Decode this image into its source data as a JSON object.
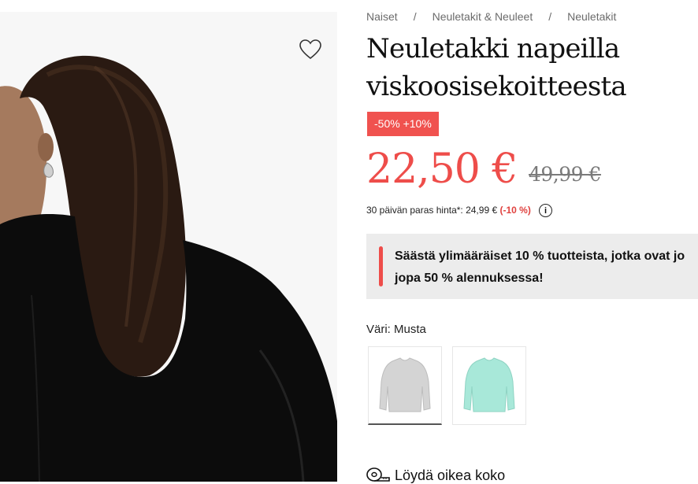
{
  "breadcrumb": [
    {
      "label": "Naiset"
    },
    {
      "label": "Neuletakit & Neuleet"
    },
    {
      "label": "Neuletakit"
    }
  ],
  "breadcrumb_separator": "/",
  "product": {
    "title": "Neuletakki napeilla viskoosisekoitteesta",
    "discount_badge": "-50% +10%",
    "price": "22,50 €",
    "original_price": "49,99 €",
    "lowest_price_text": "30 päivän paras hinta*: 24,99 €",
    "lowest_price_pct": "(-10 %)",
    "info_icon_text": "i"
  },
  "promo": {
    "text": "Säästä ylimääräiset 10 % tuotteista, jotka ovat jo jopa 50 % alennuksessa!"
  },
  "color": {
    "label": "Väri: Musta",
    "swatches": [
      {
        "name": "grey",
        "color": "#cfcfcf",
        "selected": true
      },
      {
        "name": "mint",
        "color": "#a8e8d9",
        "selected": false
      }
    ]
  },
  "size_guide": {
    "label": "Löydä oikea koko",
    "icon": "tape-measure-icon"
  },
  "icons": {
    "wishlist": "heart-icon"
  },
  "colors": {
    "accent": "#ee4d4a",
    "promo_bg": "#ececec"
  }
}
